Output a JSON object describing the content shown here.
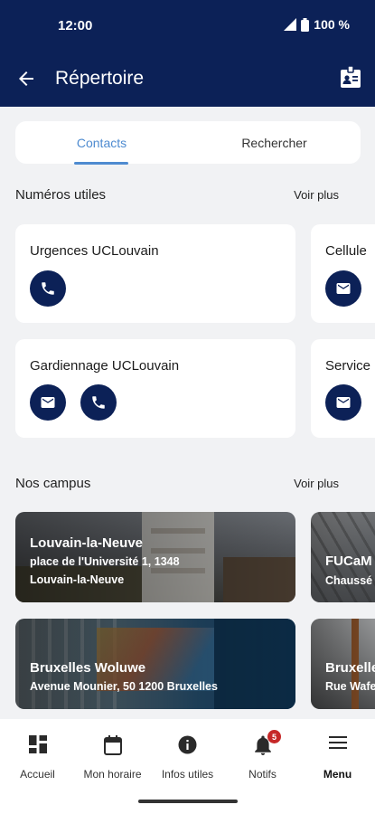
{
  "status_bar": {
    "time": "12:00",
    "battery": "100 %"
  },
  "app_bar": {
    "title": "Répertoire"
  },
  "tabs": [
    {
      "label": "Contacts"
    },
    {
      "label": "Rechercher"
    }
  ],
  "useful_numbers": {
    "title": "Numéros utiles",
    "see_more": "Voir plus",
    "cards": [
      {
        "name": "Urgences UCLouvain",
        "actions": [
          "phone"
        ]
      },
      {
        "name": "Cellule",
        "actions": [
          "email"
        ]
      },
      {
        "name": "Gardiennage UCLouvain",
        "actions": [
          "email",
          "phone"
        ]
      },
      {
        "name": "Service",
        "actions": [
          "email"
        ]
      }
    ]
  },
  "campuses": {
    "title": "Nos campus",
    "see_more": "Voir plus",
    "cards": [
      {
        "name": "Louvain-la-Neuve",
        "address_line1": "place de l'Université 1, 1348",
        "address_line2": "Louvain-la-Neuve"
      },
      {
        "name": "FUCaM",
        "address_line1": "Chaussé"
      },
      {
        "name": "Bruxelles Woluwe",
        "address_line1": "Avenue Mounier, 50 1200 Bruxelles"
      },
      {
        "name": "Bruxelle",
        "address_line1": "Rue Wafe"
      }
    ]
  },
  "bottom_nav": [
    {
      "label": "Accueil"
    },
    {
      "label": "Mon horaire"
    },
    {
      "label": "Infos utiles"
    },
    {
      "label": "Notifs",
      "badge": "5"
    },
    {
      "label": "Menu"
    }
  ]
}
